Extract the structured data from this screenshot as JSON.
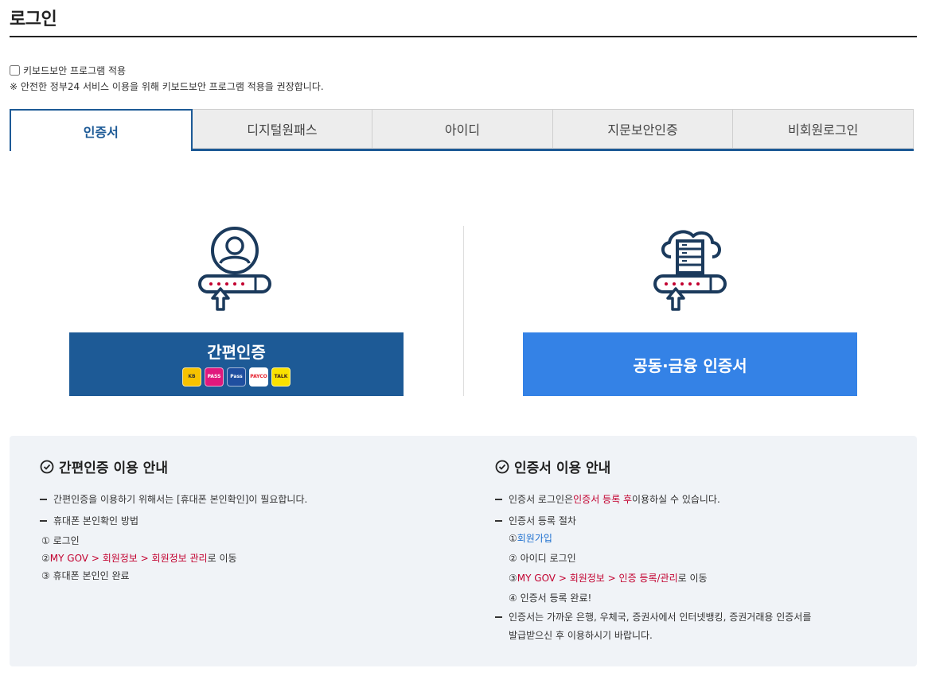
{
  "header": {
    "title": "로그인"
  },
  "keyboard_security": {
    "checkbox_label": "키보드보안 프로그램 적용",
    "checked": false,
    "note": "※ 안전한 정부24 서비스 이용을 위해 키보드보안 프로그램 적용을 권장합니다."
  },
  "tabs": [
    {
      "label": "인증서",
      "active": true
    },
    {
      "label": "디지털원패스",
      "active": false
    },
    {
      "label": "아이디",
      "active": false
    },
    {
      "label": "지문보안인증",
      "active": false
    },
    {
      "label": "비회원로그인",
      "active": false
    }
  ],
  "login_options": {
    "simple_auth": {
      "button_label": "간편인증",
      "icon": "user-password-icon",
      "providers": [
        "KB",
        "PASS",
        "Pass",
        "PAYCO",
        "TALK"
      ]
    },
    "certificate": {
      "button_label": "공동·금융 인증서",
      "icon": "cloud-server-password-icon"
    }
  },
  "guide_simple": {
    "title": "간편인증 이용 안내",
    "line1": "간편인증을 이용하기 위해서는 [휴대폰 본인확인]이 필요합니다.",
    "line2": "휴대폰 본인확인 방법",
    "step1": "① 로그인",
    "step2_prefix": "② ",
    "step2_path": "MY GOV > 회원정보 > 회원정보 관리",
    "step2_suffix": "로 이동",
    "step3": "③ 휴대폰 본인인 완료"
  },
  "guide_cert": {
    "title": "인증서 이용 안내",
    "line1_prefix": "인증서 로그인은 ",
    "line1_highlight": "인증서 등록 후",
    "line1_suffix": " 이용하실 수 있습니다.",
    "line2": "인증서 등록 절차",
    "step1_prefix": "① ",
    "step1_link": "회원가입",
    "step2": "② 아이디 로그인",
    "step3_prefix": "③ ",
    "step3_path": "MY GOV > 회원정보 > 인증 등록/관리",
    "step3_suffix": "로 이동",
    "step4": "④ 인증서 등록 완료!",
    "line3a": "인증서는 가까운 은행, 우체국, 증권사에서 인터넷뱅킹, 증권거래용 인증서를",
    "line3b": "발급받으신 후 이용하시기 바랍니다."
  },
  "colors": {
    "primary_dark": "#1d5a96",
    "primary_light": "#3482e6",
    "highlight_red": "#c2002f",
    "link_blue": "#1d6fcf",
    "guide_bg": "#f0f3f7"
  }
}
